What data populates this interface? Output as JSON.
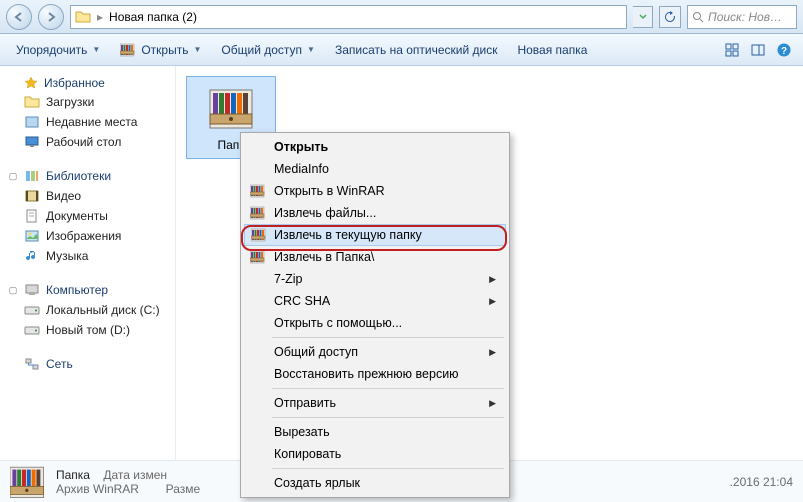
{
  "address": {
    "path_label": "Новая папка (2)",
    "search_placeholder": "Поиск: Нов…"
  },
  "toolbar": {
    "organize": "Упорядочить",
    "open": "Открыть",
    "share": "Общий доступ",
    "burn": "Записать на оптический диск",
    "new_folder": "Новая папка"
  },
  "sidebar": {
    "favorites": {
      "label": "Избранное",
      "items": [
        "Загрузки",
        "Недавние места",
        "Рабочий стол"
      ]
    },
    "libraries": {
      "label": "Библиотеки",
      "items": [
        "Видео",
        "Документы",
        "Изображения",
        "Музыка"
      ]
    },
    "computer": {
      "label": "Компьютер",
      "items": [
        "Локальный диск (C:)",
        "Новый том (D:)"
      ]
    },
    "network": {
      "label": "Сеть"
    }
  },
  "content": {
    "file": {
      "label": "Папк"
    }
  },
  "context_menu": {
    "open": "Открыть",
    "mediainfo": "MediaInfo",
    "open_winrar": "Открыть в WinRAR",
    "extract_files": "Извлечь файлы...",
    "extract_here": "Извлечь в текущую папку",
    "extract_to": "Извлечь в Папка\\",
    "sevenzip": "7-Zip",
    "crc": "CRC SHA",
    "open_with": "Открыть с помощью...",
    "share": "Общий доступ",
    "restore": "Восстановить прежнюю версию",
    "send_to": "Отправить",
    "cut": "Вырезать",
    "copy": "Копировать",
    "shortcut": "Создать ярлык"
  },
  "status": {
    "name": "Папка",
    "type": "Архив WinRAR",
    "date_label": "Дата измен",
    "size_label": "Разме",
    "date_value": ".2016 21:04"
  }
}
